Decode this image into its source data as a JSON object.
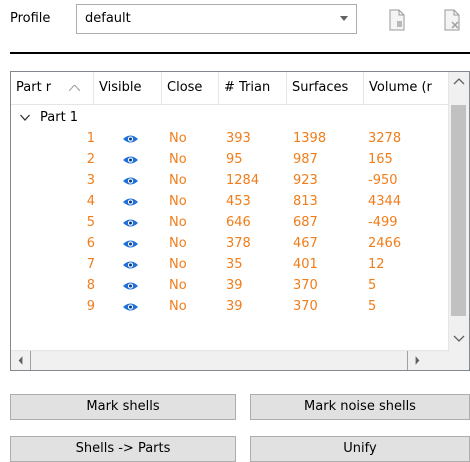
{
  "profile": {
    "label": "Profile",
    "value": "default"
  },
  "table": {
    "columns": [
      "Part r",
      "Visible",
      "Close",
      "# Trian",
      "Surfaces",
      "Volume (r"
    ],
    "group": "Part 1",
    "rows": [
      {
        "id": "1",
        "close": "No",
        "triangles": "393",
        "surfaces": "1398",
        "volume": "3278"
      },
      {
        "id": "2",
        "close": "No",
        "triangles": "95",
        "surfaces": "987",
        "volume": "165"
      },
      {
        "id": "3",
        "close": "No",
        "triangles": "1284",
        "surfaces": "923",
        "volume": "-950"
      },
      {
        "id": "4",
        "close": "No",
        "triangles": "453",
        "surfaces": "813",
        "volume": "4344"
      },
      {
        "id": "5",
        "close": "No",
        "triangles": "646",
        "surfaces": "687",
        "volume": "-499"
      },
      {
        "id": "6",
        "close": "No",
        "triangles": "378",
        "surfaces": "467",
        "volume": "2466"
      },
      {
        "id": "7",
        "close": "No",
        "triangles": "35",
        "surfaces": "401",
        "volume": "12"
      },
      {
        "id": "8",
        "close": "No",
        "triangles": "39",
        "surfaces": "370",
        "volume": "5"
      },
      {
        "id": "9",
        "close": "No",
        "triangles": "39",
        "surfaces": "370",
        "volume": "5"
      }
    ],
    "visible_icon": "eye-icon"
  },
  "buttons": {
    "mark_shells": "Mark shells",
    "mark_noise_shells": "Mark noise shells",
    "shells_to_parts": "Shells -> Parts",
    "unify": "Unify"
  },
  "colors": {
    "row_text": "#f07d1a",
    "eye": "#1e6fd9"
  }
}
